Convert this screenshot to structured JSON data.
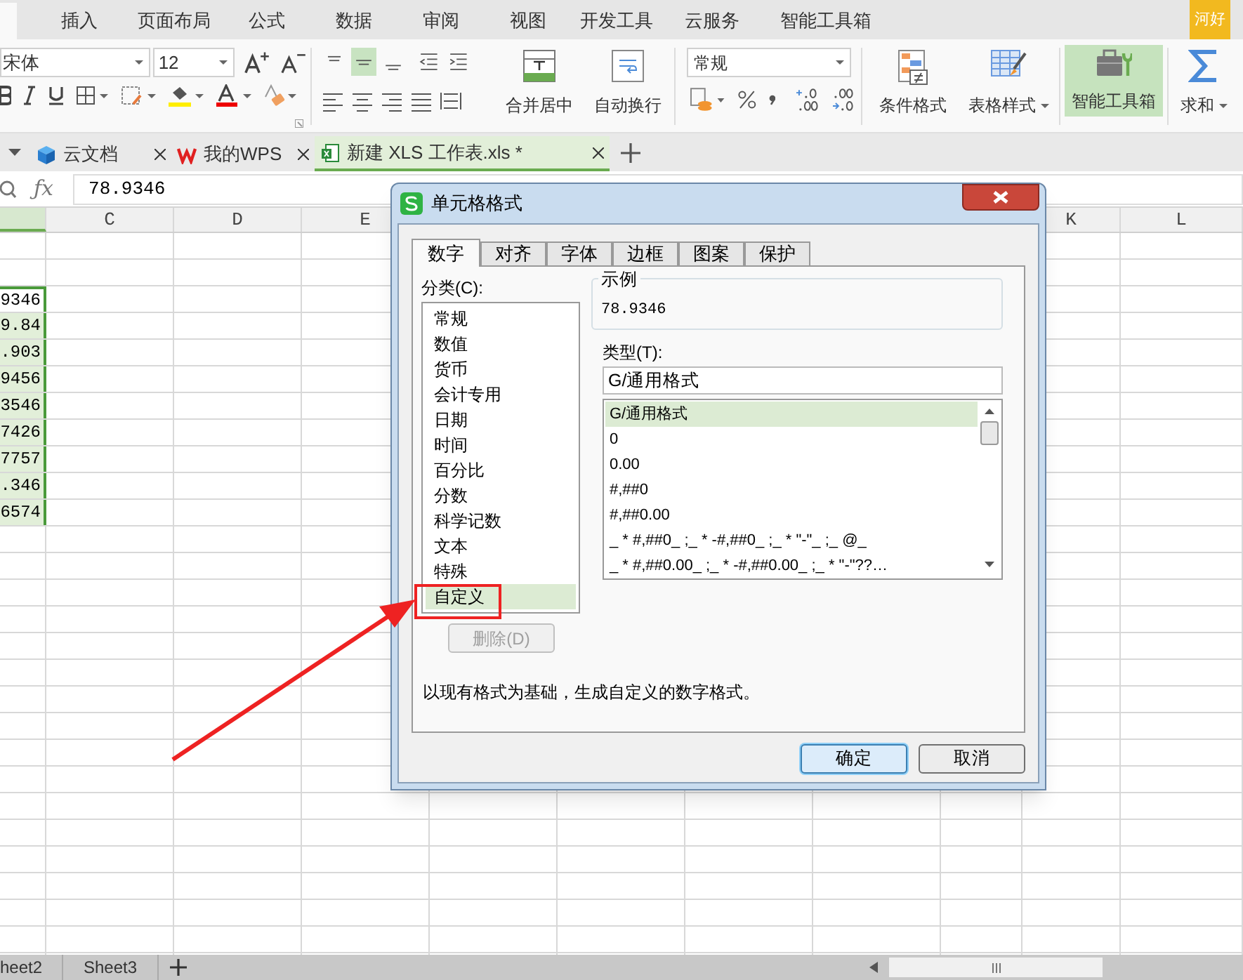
{
  "menu_tabs": [
    {
      "selected": true
    },
    {
      "label": "插入",
      "selected": false
    },
    {
      "label": "页面布局",
      "selected": false
    },
    {
      "label": "公式",
      "selected": false
    },
    {
      "label": "数据",
      "selected": false
    },
    {
      "label": "审阅",
      "selected": false
    },
    {
      "label": "视图",
      "selected": false
    },
    {
      "label": "开发工具",
      "selected": false
    },
    {
      "label": "云服务",
      "selected": false
    },
    {
      "label": "智能工具箱",
      "selected": false
    }
  ],
  "account_badge": "河好",
  "ribbon": {
    "font_name": "宋体",
    "font_size": "12",
    "merge_center": "合并居中",
    "wrap_text": "自动换行",
    "number_format": "常规",
    "conditional_format": "条件格式",
    "table_style": "表格样式",
    "smart_toolbox": {
      "label": "智能工具箱",
      "selected": true
    },
    "sum": "求和"
  },
  "doc_tabs": [
    {
      "label": "云文档",
      "kind": "cloud",
      "selected": false
    },
    {
      "label": "我的WPS",
      "kind": "wps",
      "selected": false
    },
    {
      "label": "新建 XLS 工作表.xls *",
      "kind": "sheet",
      "selected": true
    }
  ],
  "formula_bar": {
    "function_label": "ƒx",
    "value": "78.9346"
  },
  "columns": [
    {
      "selected": true
    },
    {
      "label": "C",
      "selected": false
    },
    {
      "label": "D",
      "selected": false
    },
    {
      "label": "E",
      "selected": false
    },
    {
      "label": "K",
      "selected": false
    },
    {
      "label": "L",
      "selected": false
    }
  ],
  "selected_cells": [
    {
      "value": "9346",
      "active": true
    },
    {
      "value": "9.84",
      "active": false
    },
    {
      "value": ".903",
      "active": false
    },
    {
      "value": "9456",
      "active": false
    },
    {
      "value": "3546",
      "active": false
    },
    {
      "value": "7426",
      "active": false
    },
    {
      "value": "7757",
      "active": false
    },
    {
      "value": ".346",
      "active": false
    },
    {
      "value": "6574",
      "active": false
    }
  ],
  "sheet_tabs": [
    {
      "label": "heet2"
    },
    {
      "label": "Sheet3"
    }
  ],
  "dialog": {
    "title": "单元格格式",
    "tabs": [
      {
        "label": "数字",
        "selected": true
      },
      {
        "label": "对齐",
        "selected": false
      },
      {
        "label": "字体",
        "selected": false
      },
      {
        "label": "边框",
        "selected": false
      },
      {
        "label": "图案",
        "selected": false
      },
      {
        "label": "保护",
        "selected": false
      }
    ],
    "category_label": "分类(C):",
    "categories": [
      {
        "label": "常规",
        "selected": false
      },
      {
        "label": "数值",
        "selected": false
      },
      {
        "label": "货币",
        "selected": false
      },
      {
        "label": "会计专用",
        "selected": false
      },
      {
        "label": "日期",
        "selected": false
      },
      {
        "label": "时间",
        "selected": false
      },
      {
        "label": "百分比",
        "selected": false
      },
      {
        "label": "分数",
        "selected": false
      },
      {
        "label": "科学记数",
        "selected": false
      },
      {
        "label": "文本",
        "selected": false
      },
      {
        "label": "特殊",
        "selected": false
      },
      {
        "label": "自定义",
        "selected": true
      }
    ],
    "delete_button": {
      "label": "删除(D)",
      "disabled": true
    },
    "sample": {
      "legend": "示例",
      "value": "78.9346"
    },
    "type_label": "类型(T):",
    "type_value": "G/通用格式",
    "type_options": [
      {
        "label": "G/通用格式",
        "selected": true
      },
      {
        "label": "0",
        "selected": false
      },
      {
        "label": "0.00",
        "selected": false
      },
      {
        "label": "#,##0",
        "selected": false
      },
      {
        "label": "#,##0.00",
        "selected": false
      },
      {
        "label": "_ * #,##0_ ;_ * -#,##0_ ;_ * \"-\"_ ;_ @_",
        "selected": false
      },
      {
        "label": "_ * #,##0.00_ ;_ * -#,##0.00_ ;_ * \"-\"??…",
        "selected": false
      }
    ],
    "description": "以现有格式为基础，生成自定义的数字格式。",
    "buttons": [
      {
        "label": "确定",
        "kind": "default"
      },
      {
        "label": "取消",
        "kind": "normal"
      }
    ]
  }
}
